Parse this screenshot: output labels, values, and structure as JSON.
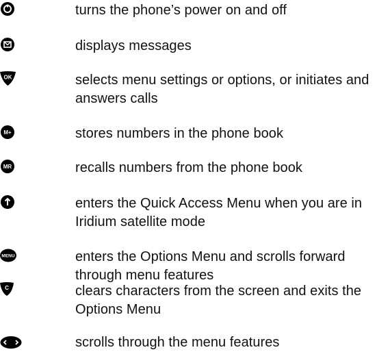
{
  "keys": [
    {
      "icon": "power-key-icon",
      "description": "turns the phone’s power on and off"
    },
    {
      "icon": "message-key-icon",
      "description": "displays messages"
    },
    {
      "icon": "ok-key-icon",
      "label": "OK",
      "description": "selects menu settings or options, or initiates and answers calls"
    },
    {
      "icon": "memory-store-key-icon",
      "label": "M+",
      "description": "stores numbers in the phone book"
    },
    {
      "icon": "memory-recall-key-icon",
      "label": "MR",
      "description": "recalls numbers from the phone book"
    },
    {
      "icon": "quick-access-key-icon",
      "description": "enters the Quick Access Menu when you are in Iridium satellite mode"
    },
    {
      "icon": "menu-key-icon",
      "label": "MENU",
      "description": "enters the Options Menu and scrolls forward through menu features"
    },
    {
      "icon": "clear-key-icon",
      "label": "C",
      "description": "clears characters from the screen and exits the Options Menu"
    },
    {
      "icon": "scroll-key-icon",
      "description": "scrolls through the menu features"
    }
  ]
}
